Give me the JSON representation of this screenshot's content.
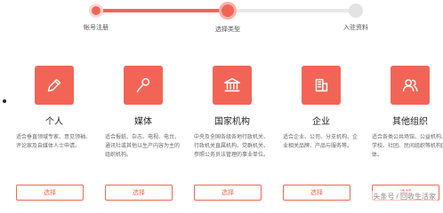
{
  "colors": {
    "accent": "#f26556",
    "track_inactive": "#e8e8e8"
  },
  "steps": [
    {
      "label": "帐号注册",
      "state": "done"
    },
    {
      "label": "选择类型",
      "state": "active"
    },
    {
      "label": "入驻资料",
      "state": "todo"
    }
  ],
  "cards": [
    {
      "icon": "pen-icon",
      "title": "个人",
      "desc": "适合垂直领域专家、意见领袖、评论家及自媒体人士申请。",
      "button": "选择"
    },
    {
      "icon": "microphone-icon",
      "title": "媒体",
      "desc": "适合报纸、杂志、电视、电台、通讯社或其他以生产内容为主的组织机构。",
      "button": "选择"
    },
    {
      "icon": "government-building-icon",
      "title": "国家机构",
      "desc": "中央及全国各级各地行政机关、行政机关直属机构、党群机关、参照公务员法管理的事业单位。",
      "button": "选择"
    },
    {
      "icon": "office-building-icon",
      "title": "企业",
      "desc": "适合企业、公司、分支机构、企业相关品牌、产品与服务等。",
      "button": "选择"
    },
    {
      "icon": "group-icon",
      "title": "其他组织",
      "desc": "适合各类公共场馆、公益机构、学校、社团、民间组织等机构团体。",
      "button": "选择"
    }
  ],
  "watermark": "头条号 / 回收生活家"
}
